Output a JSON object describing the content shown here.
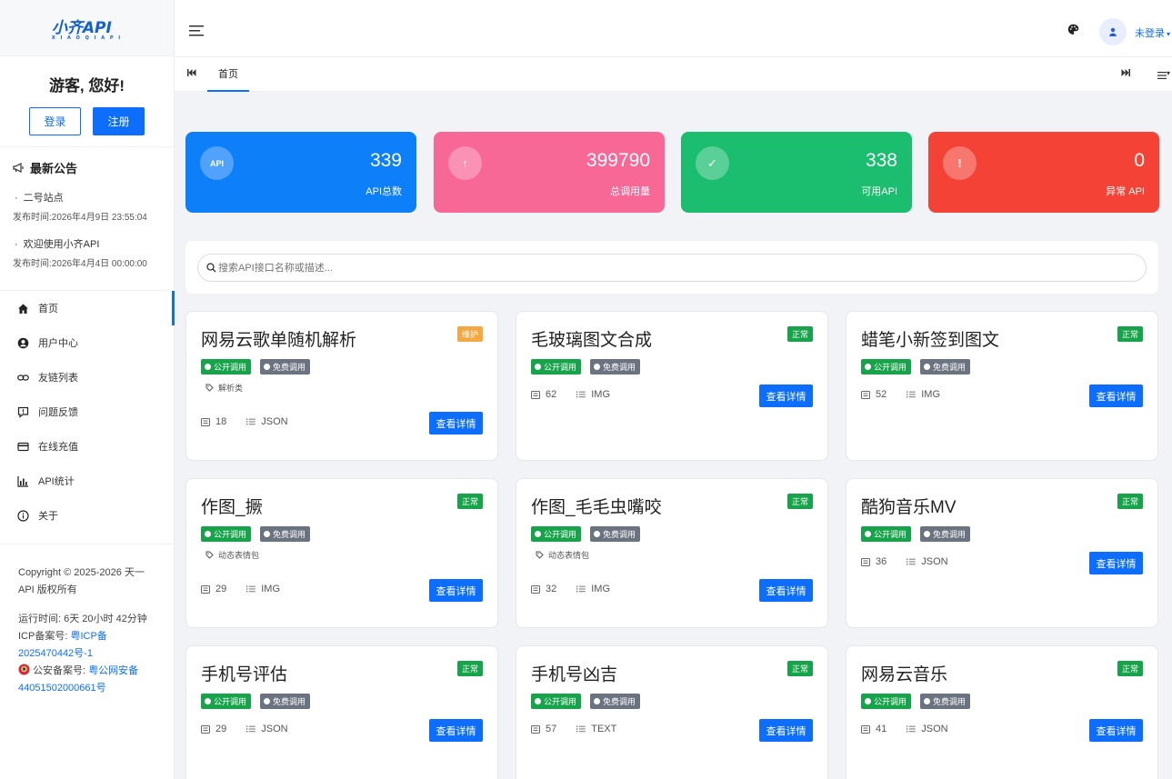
{
  "logo": {
    "text": "小齐API",
    "sub": "X I A O Q I A P I"
  },
  "greeting": {
    "title": "游客, 您好!",
    "login": "登录",
    "register": "注册"
  },
  "notice": {
    "title": "最新公告",
    "items": [
      {
        "title": "二号站点",
        "date": "发布时间:2026年4月9日 23:55:04"
      },
      {
        "title": "欢迎使用小齐API",
        "date": "发布时间:2026年4月4日 00:00:00"
      }
    ]
  },
  "nav": {
    "items": [
      {
        "label": "首页",
        "icon": "home-icon"
      },
      {
        "label": "用户中心",
        "icon": "user-circle-icon"
      },
      {
        "label": "友链列表",
        "icon": "link-icon"
      },
      {
        "label": "问题反馈",
        "icon": "feedback-icon"
      },
      {
        "label": "在线充值",
        "icon": "card-icon"
      },
      {
        "label": "API统计",
        "icon": "bar-chart-icon"
      },
      {
        "label": "关于",
        "icon": "info-icon"
      }
    ]
  },
  "footer": {
    "copyright": "Copyright © 2025-2026 天一API 版权所有",
    "uptime": "运行时间: 6天 20小时 42分钟",
    "icp_label": "ICP备案号:",
    "icp_value": "粤ICP备2025470442号-1",
    "police_label": "公安备案号:",
    "police_value": "粤公网安备44051502000661号"
  },
  "topbar": {
    "user_label": "未登录"
  },
  "tabs": {
    "home": "首页"
  },
  "stats": [
    {
      "icon_text": "API",
      "value": "339",
      "label": "API总数",
      "color": "#0d7ff8"
    },
    {
      "icon_text": "↑",
      "value": "399790",
      "label": "总调用量",
      "color": "#f76897"
    },
    {
      "icon_text": "✓",
      "value": "338",
      "label": "可用API",
      "color": "#1bbd6f"
    },
    {
      "icon_text": "!",
      "value": "0",
      "label": "异常 API",
      "color": "#f44336"
    }
  ],
  "search": {
    "placeholder": "搜索API接口名称或描述..."
  },
  "card_common": {
    "public": "公开调用",
    "free": "免费调用",
    "detail": "查看详情"
  },
  "cards": [
    {
      "title": "网易云歌单随机解析",
      "status": "维护",
      "status_color": "#f5a742",
      "tag": "解析类",
      "count": "18",
      "format": "JSON"
    },
    {
      "title": "毛玻璃图文合成",
      "status": "正常",
      "status_color": "#16a34a",
      "tag": "",
      "count": "62",
      "format": "IMG"
    },
    {
      "title": "蜡笔小新签到图文",
      "status": "正常",
      "status_color": "#16a34a",
      "tag": "",
      "count": "52",
      "format": "IMG"
    },
    {
      "title": "作图_撅",
      "status": "正常",
      "status_color": "#16a34a",
      "tag": "动态表情包",
      "count": "29",
      "format": "IMG"
    },
    {
      "title": "作图_毛毛虫嘴咬",
      "status": "正常",
      "status_color": "#16a34a",
      "tag": "动态表情包",
      "count": "32",
      "format": "IMG"
    },
    {
      "title": "酷狗音乐MV",
      "status": "正常",
      "status_color": "#16a34a",
      "tag": "",
      "count": "36",
      "format": "JSON"
    },
    {
      "title": "手机号评估",
      "status": "正常",
      "status_color": "#16a34a",
      "tag": "",
      "count": "29",
      "format": "JSON"
    },
    {
      "title": "手机号凶吉",
      "status": "正常",
      "status_color": "#16a34a",
      "tag": "",
      "count": "57",
      "format": "TEXT"
    },
    {
      "title": "网易云音乐",
      "status": "正常",
      "status_color": "#16a34a",
      "tag": "",
      "count": "41",
      "format": "JSON"
    }
  ]
}
